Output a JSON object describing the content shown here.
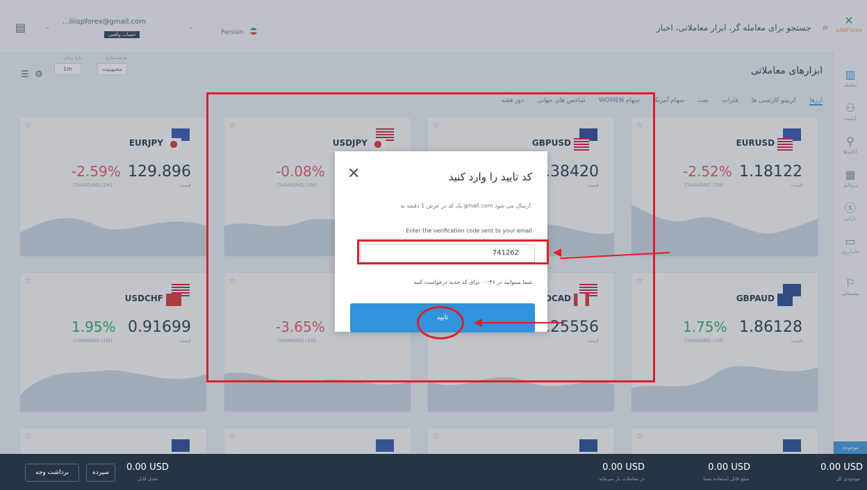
{
  "topbar": {
    "search_placeholder": "جستجو برای معامله گر، ابزار معاملاتی، اخبار",
    "logo_text": "LiteForex",
    "language": "Persian",
    "account_email": "...iliispforex@gmail.com",
    "account_badge": "حساب واقعی"
  },
  "toolbar": {
    "section_title": "ابزارهای معاملاتی",
    "sort_label": "مرتب سازی",
    "sort_value": "محبوبیت",
    "timeframe_label": "بازه زمانی",
    "timeframe_value": "1m"
  },
  "tabs": [
    {
      "label": "ارزها"
    },
    {
      "label": "کریپتو کارنسی ها"
    },
    {
      "label": "فلزات"
    },
    {
      "label": "نفت"
    },
    {
      "label": "سهام آمریکا"
    },
    {
      "label": "سهام WOMEN"
    },
    {
      "label": "شاخص های جهانی"
    },
    {
      "label": "دوز هفته"
    }
  ],
  "sidebar": {
    "items": [
      {
        "label": "معامله",
        "icon": "chart-icon"
      },
      {
        "label": "لیست",
        "icon": "people-icon"
      },
      {
        "label": "آنالیزها",
        "icon": "analysis-icon"
      },
      {
        "label": "پروفایل",
        "icon": "profile-icon"
      },
      {
        "label": "دارایی",
        "icon": "dollar-icon"
      },
      {
        "label": "خانه‌ارزی",
        "icon": "calendar-icon"
      },
      {
        "label": "پشتیبانی",
        "icon": "support-icon"
      }
    ]
  },
  "cards": [
    {
      "symbol": "EURUSD",
      "price": "1.18122",
      "change": "-2.52%",
      "price_label": "قیمت",
      "change_label": "CHANGING (1M)",
      "trend": "neg"
    },
    {
      "symbol": "GBPUSD",
      "price": "1.38420",
      "change": "",
      "price_label": "قیمت",
      "change_label": "",
      "trend": "neg"
    },
    {
      "symbol": "USDJPY",
      "price": "",
      "change": "-0.08%",
      "price_label": "",
      "change_label": "CHANGING (1M)",
      "trend": "neg"
    },
    {
      "symbol": "EURJPY",
      "price": "129.896",
      "change": "-2.59%",
      "price_label": "قیمت",
      "change_label": "CHANGING (1M)",
      "trend": "neg"
    },
    {
      "symbol": "GBPAUD",
      "price": "1.86128",
      "change": "1.75%",
      "price_label": "قیمت",
      "change_label": "CHANGING (1M)",
      "trend": "pos"
    },
    {
      "symbol": "USDCAD",
      "price": "1.25556",
      "change": "",
      "price_label": "قیمت",
      "change_label": "",
      "trend": "neg"
    },
    {
      "symbol": "",
      "price": "",
      "change": "-3.65%",
      "price_label": "",
      "change_label": "CHANGING (1M)",
      "trend": "neg"
    },
    {
      "symbol": "USDCHF",
      "price": "0.91699",
      "change": "1.95%",
      "price_label": "قیمت",
      "change_label": "CHANGING (1M)",
      "trend": "pos"
    }
  ],
  "modal": {
    "title": "کد تایید را وارد کنید",
    "close_icon": "close-icon",
    "info_text": "یک کد در عرض 1 دقیقه به gmail.com ارسال می شود.",
    "instruction": "Enter the verification code sent to your email",
    "code_value": "741262",
    "resend_text": "شما میتوانید در ۰۰:۴۶ برای کد جدید درخواست کنید",
    "confirm_label": "تایید"
  },
  "bottombar": {
    "balances": [
      {
        "amount": "0.00 USD",
        "label": "موجودی کل"
      },
      {
        "amount": "0.00 USD",
        "label": "مبلغ قابل استفاده شما"
      },
      {
        "amount": "0.00 USD",
        "label": "در معاملات باز سرمایه"
      },
      {
        "amount": "0.00 USD",
        "label": "نقدی قابل"
      }
    ],
    "deposit_label": "سپرده",
    "withdraw_label": "برداشت وجه",
    "side_tag": "موجودی"
  },
  "colors": {
    "highlight": "#e01e2a",
    "primary": "#2f94db",
    "negative": "#e34b5a",
    "positive": "#25a05a"
  }
}
